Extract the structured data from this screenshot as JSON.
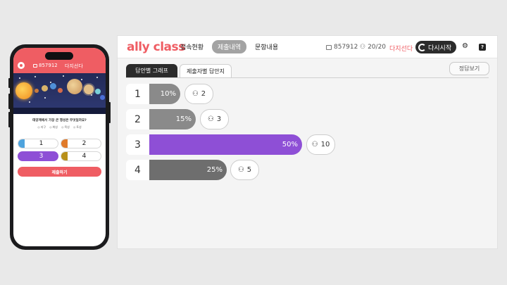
{
  "phone": {
    "code": "857912",
    "name": "다지선다",
    "question": "태양계에서 가장 큰 행성은 무엇일까요?",
    "choices_text": [
      "지구",
      "화성",
      "목성",
      "토성"
    ],
    "answers": [
      {
        "label": "1",
        "color": "#4ea3dd",
        "selected": false
      },
      {
        "label": "2",
        "color": "#e07a2a",
        "selected": false
      },
      {
        "label": "3",
        "color": "#8e4fd6",
        "selected": true
      },
      {
        "label": "4",
        "color": "#b8901a",
        "selected": false
      }
    ],
    "submit": "제출하기"
  },
  "header": {
    "brand": "ally class",
    "nav": [
      "접속현황",
      "제출내역",
      "문항내용"
    ],
    "active_nav": "제출내역",
    "code": "857912",
    "participants": "20/20",
    "type": "다지선다",
    "restart": "다시시작"
  },
  "tabs": {
    "graph": "답안별 그래프",
    "sheet": "제출자별 답안지"
  },
  "answer_button": "정답보기",
  "colors": {
    "accent": "#ef5d63",
    "bar_default": "#8a8a8a",
    "bar_selected": "#8e4fd6",
    "bar_dark": "#6e6e6e"
  },
  "results": [
    {
      "index": "1",
      "percent": "10%",
      "value": 10,
      "count": "2"
    },
    {
      "index": "2",
      "percent": "15%",
      "value": 15,
      "count": "3"
    },
    {
      "index": "3",
      "percent": "50%",
      "value": 50,
      "count": "10",
      "correct": true
    },
    {
      "index": "4",
      "percent": "25%",
      "value": 25,
      "count": "5"
    }
  ]
}
